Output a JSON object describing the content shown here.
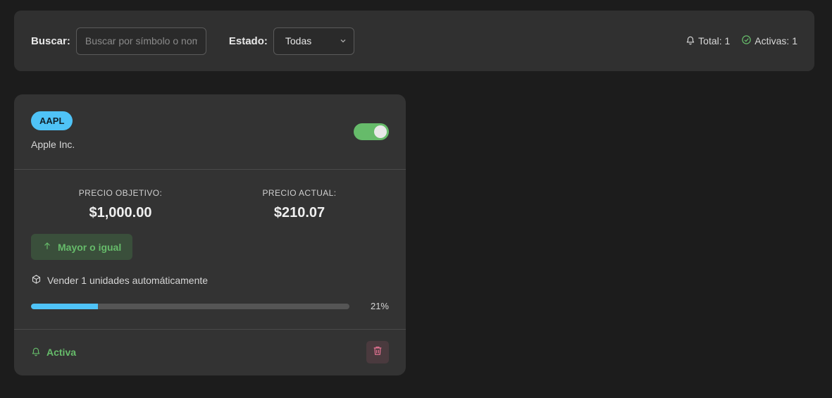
{
  "filters": {
    "search_label": "Buscar:",
    "search_placeholder": "Buscar por símbolo o nombre...",
    "search_value": "",
    "estado_label": "Estado:",
    "estado_selected": "Todas"
  },
  "stats": {
    "total": "Total: 1",
    "activas": "Activas: 1"
  },
  "alert": {
    "symbol": "AAPL",
    "company": "Apple Inc.",
    "enabled": true,
    "target_label": "PRECIO OBJETIVO:",
    "target_value": "$1,000.00",
    "current_label": "PRECIO ACTUAL:",
    "current_value": "$210.07",
    "condition": "Mayor o igual",
    "auto_sell": "Vender 1 unidades automáticamente",
    "progress_percent": 21,
    "progress_text": "21%",
    "status": "Activa"
  },
  "colors": {
    "accent_blue": "#4fc3f7",
    "success_green": "#66bb6a",
    "danger_pink": "#e57393"
  },
  "icons": {
    "bell": "bell-icon",
    "check": "check-circle-icon",
    "chevron": "chevron-down-icon",
    "arrow_up": "arrow-up-icon",
    "package": "package-icon",
    "trash": "trash-icon"
  }
}
